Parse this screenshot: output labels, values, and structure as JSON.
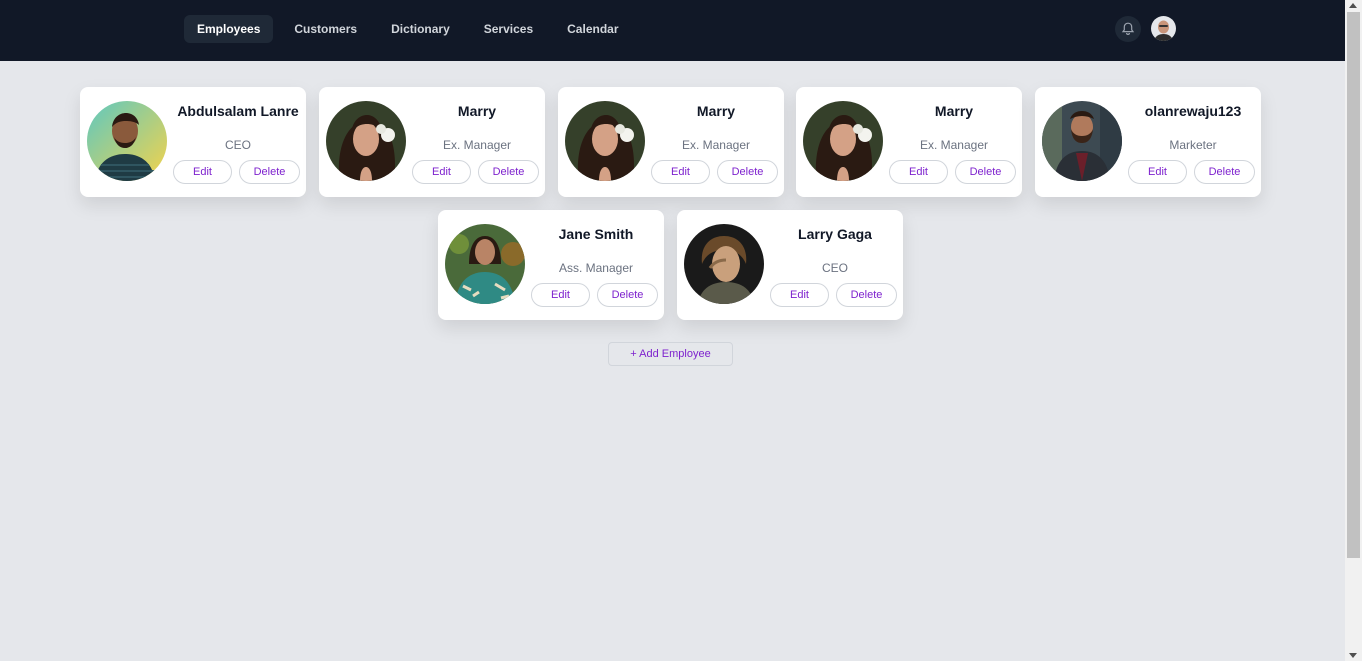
{
  "nav": {
    "tabs": [
      "Employees",
      "Customers",
      "Dictionary",
      "Services",
      "Calendar"
    ],
    "active_tab": "Employees",
    "icons": {
      "notifications": "bell-icon",
      "profile": "user-avatar"
    }
  },
  "employees": [
    {
      "name": "Abdulsalam Lanre",
      "role": "CEO",
      "edit_label": "Edit",
      "delete_label": "Delete"
    },
    {
      "name": "Marry",
      "role": "Ex. Manager",
      "edit_label": "Edit",
      "delete_label": "Delete"
    },
    {
      "name": "Marry",
      "role": "Ex. Manager",
      "edit_label": "Edit",
      "delete_label": "Delete"
    },
    {
      "name": "Marry",
      "role": "Ex. Manager",
      "edit_label": "Edit",
      "delete_label": "Delete"
    },
    {
      "name": "olanrewaju123",
      "role": "Marketer",
      "edit_label": "Edit",
      "delete_label": "Delete"
    },
    {
      "name": "Jane Smith",
      "role": "Ass. Manager",
      "edit_label": "Edit",
      "delete_label": "Delete"
    },
    {
      "name": "Larry Gaga",
      "role": "CEO",
      "edit_label": "Edit",
      "delete_label": "Delete"
    }
  ],
  "add_employee_label": "+ Add Employee",
  "colors": {
    "navbar": "#111827",
    "page_background": "#e5e7eb",
    "accent": "#7e22ce",
    "card": "#ffffff"
  }
}
